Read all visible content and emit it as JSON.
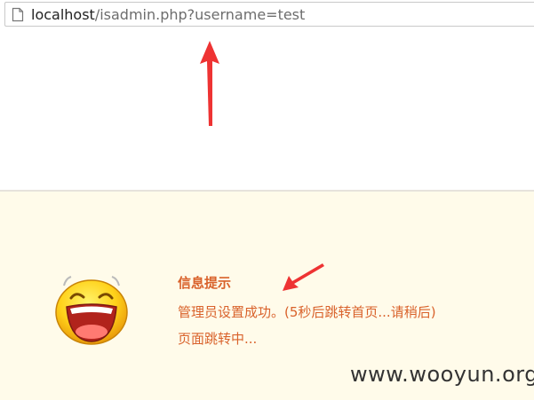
{
  "address_bar": {
    "url_host": "localhost",
    "url_path": "/isadmin.php?username=test",
    "page_icon": "page-icon"
  },
  "message": {
    "title": "信息提示",
    "line1": "管理员设置成功。(5秒后跳转首页...请稍后)",
    "line2": "页面跳转中...",
    "emoji_icon": "laughing-face-icon"
  },
  "watermark": "www.wooyun.org",
  "annotations": {
    "arrow_color": "#ee3333"
  },
  "colors": {
    "message_text": "#d9622b",
    "panel_background": "#fffbea"
  }
}
